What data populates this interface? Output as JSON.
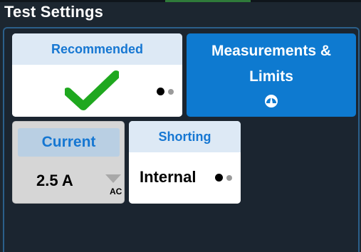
{
  "page": {
    "title": "Test Settings"
  },
  "tiles": {
    "recommended": {
      "label": "Recommended",
      "icon": "checkmark-icon"
    },
    "measurements": {
      "line1": "Measurements &",
      "line2": "Limits",
      "icon": "gauge-icon"
    },
    "current": {
      "label": "Current",
      "value": "2.5 A",
      "unit": "AC",
      "icon": "dropdown-triangle-icon"
    },
    "shorting": {
      "label": "Shorting",
      "value": "Internal"
    }
  },
  "colors": {
    "accent_blue": "#0e7ad0",
    "header_text_blue": "#1677d2",
    "check_green": "#1fa81f",
    "background": "#1c2630"
  }
}
